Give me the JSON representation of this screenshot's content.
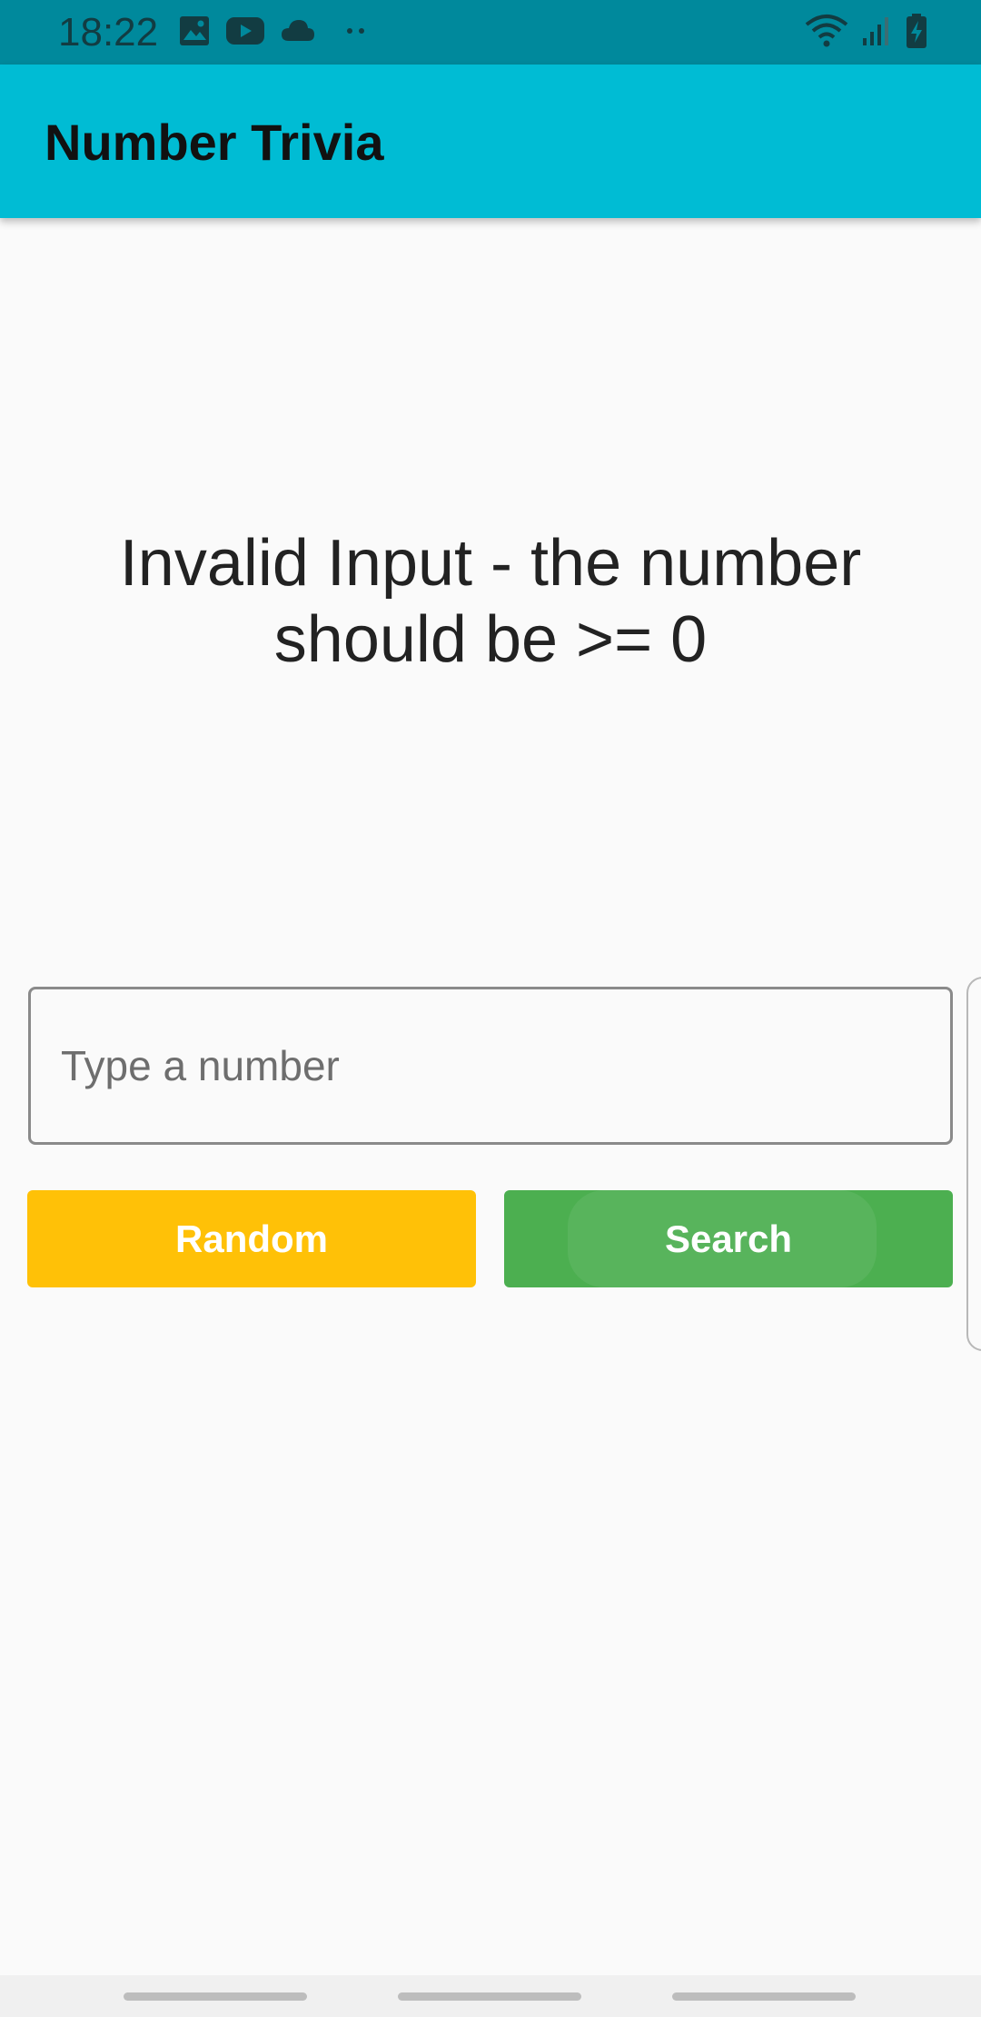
{
  "status_bar": {
    "time": "18:22",
    "left_icons": [
      "image-icon",
      "youtube-icon",
      "cloud-icon",
      "more-dots-icon"
    ],
    "right_icons": [
      "wifi-icon",
      "signal-icon",
      "battery-charging-icon"
    ]
  },
  "app_bar": {
    "title": "Number Trivia"
  },
  "message": {
    "line1": "Invalid Input - the number",
    "line2": "should be >= 0"
  },
  "input": {
    "placeholder": "Type a number",
    "value": ""
  },
  "buttons": {
    "random_label": "Random",
    "search_label": "Search"
  },
  "colors": {
    "status_bar": "#00899c",
    "app_bar": "#00bcd4",
    "random": "#ffc107",
    "search": "#4caf50"
  }
}
